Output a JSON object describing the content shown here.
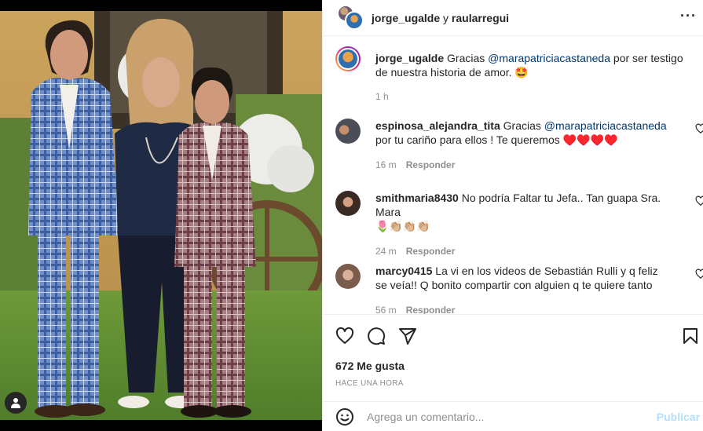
{
  "post": {
    "author": "jorge_ugalde",
    "conjunction": "y",
    "coauthor": "raularregui",
    "more_icon": "more-horizontal-icon",
    "tag_icon": "user-tag-icon"
  },
  "caption": {
    "username": "jorge_ugalde",
    "text_before": "Gracias ",
    "mention": "@marapatriciacastaneda",
    "text_after": " por ser testigo de nuestra historia de amor. 🤩",
    "time": "1 h"
  },
  "comments": [
    {
      "username": "espinosa_alejandra_tita",
      "text_before": "Gracias ",
      "mention": "@marapatriciacastaneda",
      "text_after": " por tu cariño para ellos ! Te queremos ",
      "hearts": "♥️♥️♥️♥️",
      "time": "16 m",
      "reply": "Responder"
    },
    {
      "username": "smithmaria8430",
      "text": "No podría Faltar tu Jefa.. Tan guapa Sra. Mara",
      "emoji_line": "🌷👏🏼👏🏼👏🏼",
      "time": "24 m",
      "reply": "Responder"
    },
    {
      "username": "marcy0415",
      "text": "La vi en los videos de Sebastián Rulli y q feliz se veía!! Q bonito compartir con alguien q te quiere tanto",
      "time": "56 m",
      "reply": "Responder"
    }
  ],
  "actions": {
    "like_icon": "heart-icon",
    "comment_icon": "comment-icon",
    "share_icon": "send-icon",
    "save_icon": "bookmark-icon",
    "likes": "672 Me gusta",
    "timestamp": "HACE UNA HORA"
  },
  "add_comment": {
    "placeholder": "Agrega un comentario...",
    "publish": "Publicar",
    "emoji_icon": "emoji-icon"
  },
  "colors": {
    "link": "#00376b",
    "muted": "#8e8e8e",
    "publish_disabled": "#b2dffc",
    "heart": "#ed1c24"
  }
}
